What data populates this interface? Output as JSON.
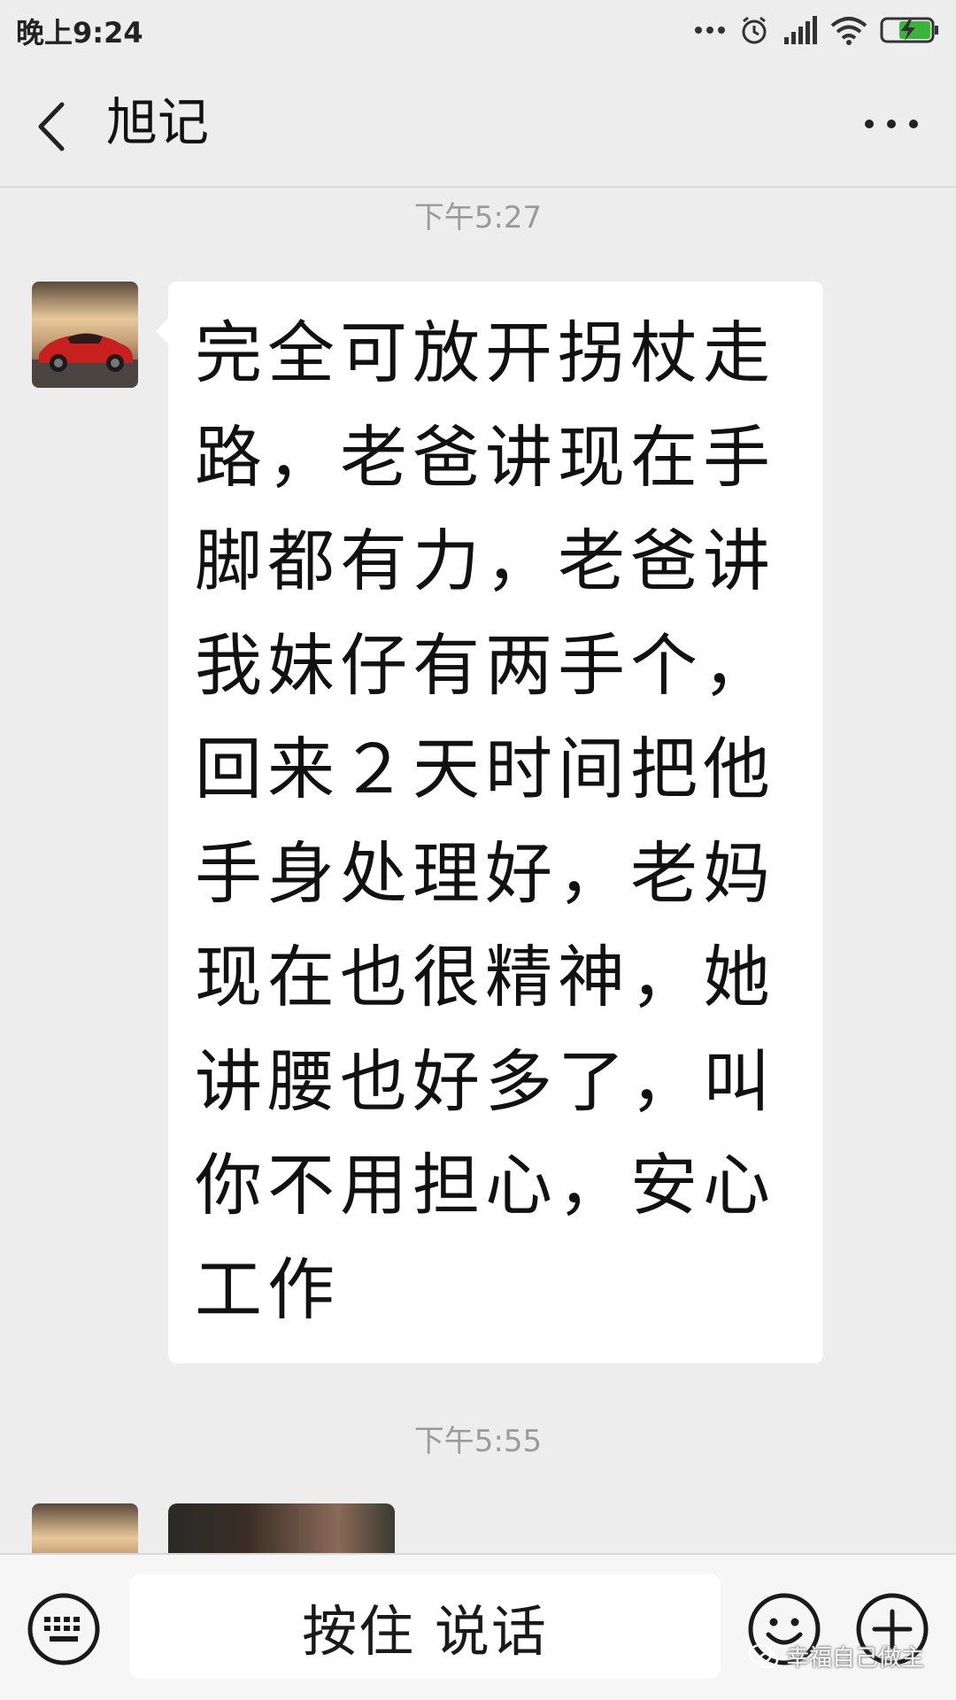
{
  "status_bar": {
    "time": "晚上9:24",
    "icons": [
      "dots-icon",
      "alarm-icon",
      "signal-icon",
      "wifi-icon",
      "battery-charging-icon"
    ]
  },
  "header": {
    "title": "旭记",
    "back_icon": "chevron-left-icon",
    "more_icon": "more-dots-icon"
  },
  "messages": [
    {
      "timestamp": "下午5:27",
      "type": "text",
      "text": "完全可放开拐杖走路，老爸讲现在手脚都有力，老爸讲我妹仔有两手个，回来２天时间把他手身处理好，老妈现在也很精神，她讲腰也好多了，叫你不用担心，安心工作"
    },
    {
      "timestamp": "下午5:55",
      "type": "image"
    }
  ],
  "input_bar": {
    "voice_label": "按住 说话",
    "icons": [
      "keyboard-icon",
      "emoji-icon",
      "plus-icon"
    ]
  },
  "watermark": {
    "text": "幸福自己做主",
    "icon": "wechat-icon"
  },
  "colors": {
    "background": "#ededed",
    "bubble": "#ffffff",
    "timestamp": "#9b9b9b",
    "bottom_bar": "#f6f6f6"
  }
}
